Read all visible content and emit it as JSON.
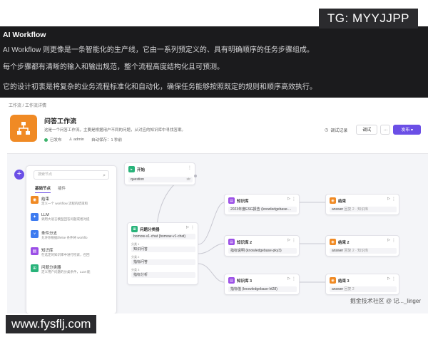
{
  "top_panel": {
    "title": "AI Workflow",
    "line1": "AI Workflow 则更像是一条智能化的生产线，它由一系列预定义的、具有明确顺序的任务步骤组成。",
    "line2": "每个步骤都有清晰的输入和输出规范，整个流程高度结构化且可预测。",
    "line3": "它的设计初衷是将复杂的业务流程标准化和自动化，确保任务能够按照既定的规则和顺序高效执行。"
  },
  "tg_badge": "TG: MYYJJPP",
  "app": {
    "breadcrumb": "工作流 / 工作流详情",
    "workflow": {
      "title": "问答工作流",
      "description": "这是一个问答工作流，主要是根据用户不同的问题，从对应的知识库中寻找答案。",
      "status": "已发布",
      "author": "admin",
      "autosave": "自动保存：1 秒前"
    },
    "actions": {
      "debug_log": "调试记录",
      "debug": "调试",
      "more": "···",
      "publish": "发布 ▾"
    }
  },
  "node_panel": {
    "search_placeholder": "搜索节点",
    "tabs": [
      "基础节点",
      "插件"
    ],
    "items": [
      {
        "title": "结束",
        "desc": "定义一个 workflow 流程的结束和",
        "color": "#f08a24"
      },
      {
        "title": "LLM",
        "desc": "调用大语言模型回答问题或者对提",
        "color": "#3d7bf0"
      },
      {
        "title": "条件分支",
        "desc": "允许你根据if/else 条件将 workflo",
        "color": "#3d7bf0"
      },
      {
        "title": "知识库",
        "desc": "在选定的知识库中进行检索，召回",
        "color": "#9b4fe6"
      },
      {
        "title": "问题分类器",
        "desc": "定义用户问题的分类条件，LLM 能",
        "color": "#28b37a"
      }
    ]
  },
  "canvas": {
    "start_node": {
      "title": "开始",
      "field": "question",
      "field_type": "str"
    },
    "classifier": {
      "title": "问题分类器",
      "model": "bomow-v1-chat (bomow-v1-chat)",
      "cases": [
        {
          "label": "分类 1",
          "value": "知识问答"
        },
        {
          "label": "分类 2",
          "value": "指标问答"
        },
        {
          "label": "分类 3",
          "value": "指标分析"
        }
      ]
    },
    "knowledge_nodes": [
      {
        "title": "知识库",
        "field": "2023年度ESG报告 (knowledgebase-..."
      },
      {
        "title": "知识库 2",
        "field": "指标说明 (knowledgebase-pky3)"
      },
      {
        "title": "知识库 3",
        "field": "指标值 (knowledgebase-lrt28)"
      }
    ],
    "end_nodes": [
      {
        "title": "结束",
        "field": "answer",
        "extra": "回复 2 · 知识库"
      },
      {
        "title": "结束 2",
        "field": "answer",
        "extra": "回复 2 · 知识库"
      },
      {
        "title": "结束 3",
        "field": "answer",
        "extra": "回复 2"
      }
    ]
  },
  "watermarks": {
    "url": "www.fysflj.com",
    "community": "掘金技术社区 @ 记..._linger"
  }
}
